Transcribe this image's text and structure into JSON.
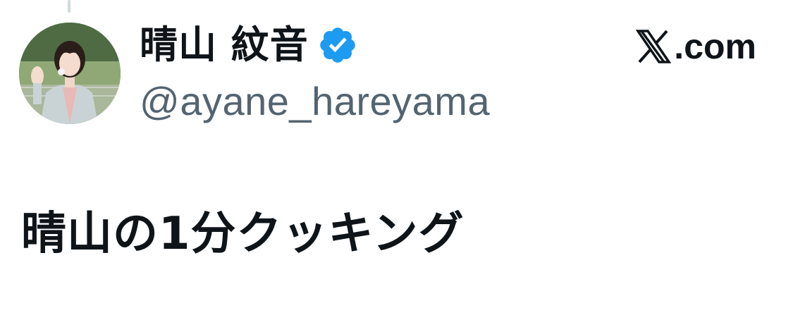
{
  "author": {
    "display_name": "晴山 紋音",
    "handle": "@ayane_hareyama",
    "verified": true,
    "verified_icon": "verified-badge-icon",
    "avatar_icon": "profile-photo"
  },
  "brand": {
    "label": ".com",
    "logo_icon": "x-logo-icon"
  },
  "tweet": {
    "text": "晴山の1分クッキング"
  },
  "colors": {
    "text_primary": "#0f1419",
    "text_secondary": "#536471",
    "verified_blue": "#1d9bf0",
    "thread_line": "#cfd9de"
  }
}
